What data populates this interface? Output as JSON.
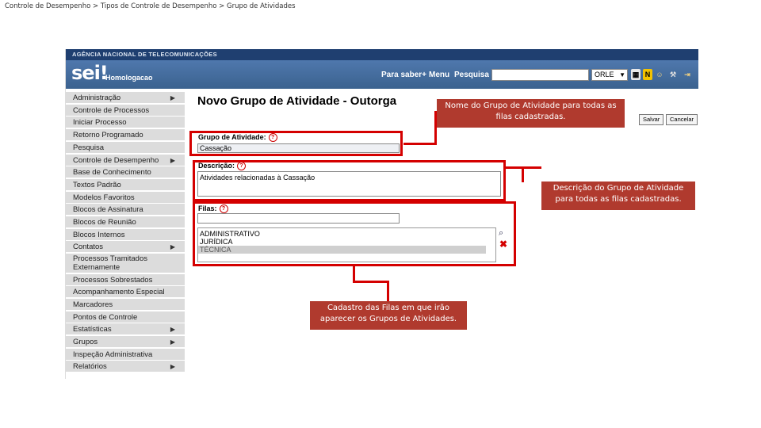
{
  "breadcrumb": "Controle de Desempenho > Tipos de Controle de Desempenho > Grupo de Atividades",
  "sei": {
    "agency": "AGÊNCIA NACIONAL DE TELECOMUNICAÇÕES",
    "logo": "sei!",
    "environment": "Homologacao",
    "nav": {
      "help": "Para saber+",
      "menu": "Menu",
      "search": "Pesquisa"
    },
    "search_value": "",
    "unit": "ORLE",
    "header_icons": [
      "grid-icon",
      "notification-icon",
      "user-icon",
      "tools-icon",
      "logout-icon"
    ]
  },
  "menu": [
    {
      "label": "Administração",
      "submenu": true
    },
    {
      "label": "Controle de Processos",
      "submenu": false
    },
    {
      "label": "Iniciar Processo",
      "submenu": false
    },
    {
      "label": "Retorno Programado",
      "submenu": false
    },
    {
      "label": "Pesquisa",
      "submenu": false
    },
    {
      "label": "Controle de Desempenho",
      "submenu": true
    },
    {
      "label": "Base de Conhecimento",
      "submenu": false
    },
    {
      "label": "Textos Padrão",
      "submenu": false
    },
    {
      "label": "Modelos Favoritos",
      "submenu": false
    },
    {
      "label": "Blocos de Assinatura",
      "submenu": false
    },
    {
      "label": "Blocos de Reunião",
      "submenu": false
    },
    {
      "label": "Blocos Internos",
      "submenu": false
    },
    {
      "label": "Contatos",
      "submenu": true
    },
    {
      "label": "Processos Tramitados Externamente",
      "submenu": false
    },
    {
      "label": "Processos Sobrestados",
      "submenu": false
    },
    {
      "label": "Acompanhamento Especial",
      "submenu": false
    },
    {
      "label": "Marcadores",
      "submenu": false
    },
    {
      "label": "Pontos de Controle",
      "submenu": false
    },
    {
      "label": "Estatísticas",
      "submenu": true
    },
    {
      "label": "Grupos",
      "submenu": true
    },
    {
      "label": "Inspeção Administrativa",
      "submenu": false
    },
    {
      "label": "Relatórios",
      "submenu": true
    }
  ],
  "form": {
    "title": "Novo Grupo de Atividade - Outorga",
    "save_label": "Salvar",
    "cancel_label": "Cancelar",
    "grupo_label": "Grupo de Atividade:",
    "grupo_value": "Cassação",
    "descricao_label": "Descrição:",
    "descricao_value": "Atividades relacionadas à Cassação",
    "filas_label": "Filas:",
    "filas_input": "",
    "filas_options": [
      "ADMINISTRATIVO",
      "JURÍDICA",
      "TÉCNICA"
    ],
    "filas_selected": "TÉCNICA"
  },
  "callouts": {
    "nome": "Nome do Grupo de Atividade para todas as filas cadastradas.",
    "descricao": "Descrição do Grupo de Atividade para todas as filas cadastradas.",
    "filas": "Cadastro das Filas em que irão aparecer os Grupos de Atividades."
  },
  "colors": {
    "header": "#3b628f",
    "callout": "#b03a2e",
    "highlight": "#d40000",
    "menu_bg": "#dcdcdc"
  }
}
